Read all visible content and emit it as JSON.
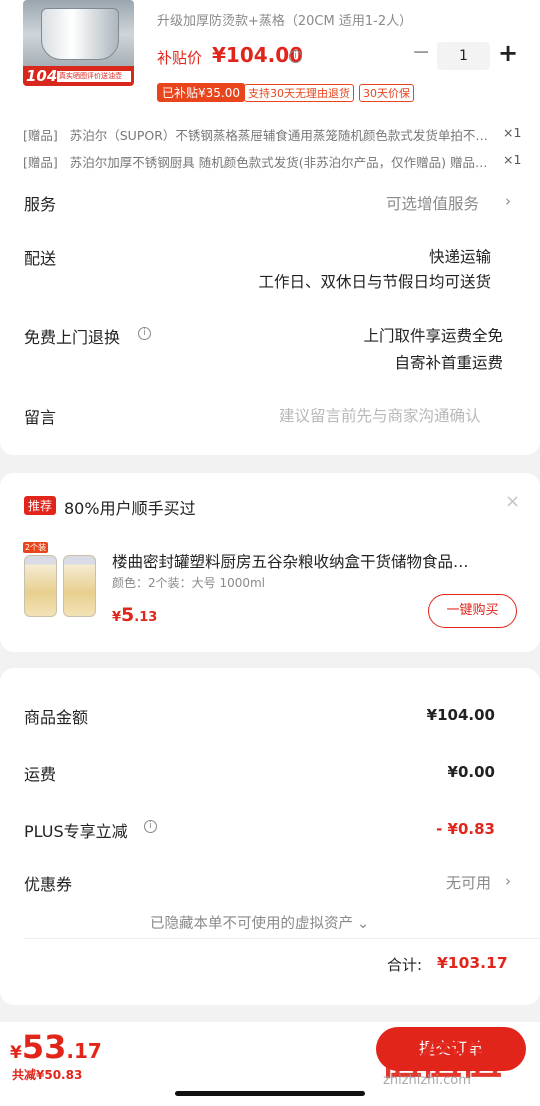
{
  "product": {
    "spec": "升级加厚防烫款+蒸格（20CM 适用1-2人）",
    "thumb_price": "104",
    "thumb_band_text": "真实晒图评价送油壶",
    "subsidy_label": "补贴价",
    "price": "¥104.00",
    "quantity": "1",
    "minus": "−",
    "plus": "+",
    "tags": [
      "已补贴¥35.00",
      "支持30天无理由退货",
      "30天价保"
    ]
  },
  "gifts": [
    {
      "label": "[赠品]",
      "text": "苏泊尔（SUPOR）不锈钢蒸格蒸屉辅食通用蒸笼随机颜色款式发货单拍不…",
      "qty": "×1"
    },
    {
      "label": "[赠品]",
      "text": "苏泊尔加厚不锈钢厨具 随机颜色款式发货(非苏泊尔产品，仅作赠品) 赠品…",
      "qty": "×1"
    }
  ],
  "service": {
    "label": "服务",
    "value": "可选增值服务"
  },
  "delivery": {
    "label": "配送",
    "line1": "快递运输",
    "line2": "工作日、双休日与节假日均可送货"
  },
  "return": {
    "label": "免费上门退换",
    "line1": "上门取件享运费全免",
    "line2": "自寄补首重运费"
  },
  "message": {
    "label": "留言",
    "placeholder": "建议留言前先与商家沟通确认"
  },
  "recommend": {
    "tag": "推荐",
    "title": "80%用户顺手买过",
    "close": "×",
    "badge": "2个装",
    "item_title": "楼曲密封罐塑料厨房五谷杂粮收纳盒干货储物食品…",
    "item_spec": "颜色：2个装：大号 1000ml",
    "price_int": "5",
    "price_dec": ".13",
    "buy_label": "一键购买"
  },
  "summary": {
    "goods_label": "商品金额",
    "goods_value": "¥104.00",
    "freight_label": "运费",
    "freight_value": "¥0.00",
    "plus_label": "PLUS专享立减",
    "plus_value": "- ¥0.83",
    "coupon_label": "优惠券",
    "coupon_value": "无可用",
    "hidden_assets": "已隐藏本单不可使用的虚拟资产",
    "total_label": "合计:",
    "total_value": "¥103.17"
  },
  "bottom": {
    "price_int": "53",
    "price_dec": ".17",
    "saved": "共减¥50.83",
    "submit_label": "提交订单"
  },
  "watermark": {
    "text": "值值值",
    "url": "zhizhizhi.com"
  },
  "colors": {
    "accent": "#e1251b",
    "orange": "#e9451d",
    "muted": "#8a8a8a",
    "background": "#f2f2f2"
  }
}
